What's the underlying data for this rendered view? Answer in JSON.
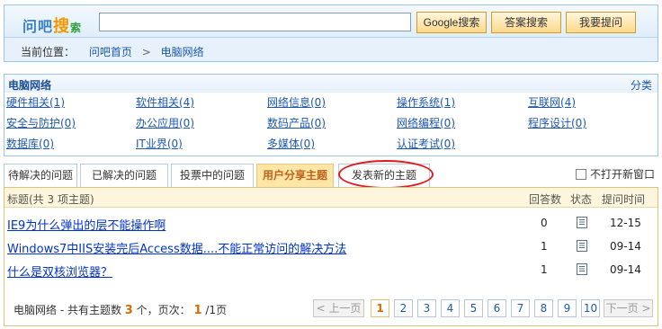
{
  "header": {
    "logo_a": "问吧",
    "logo_b": "搜",
    "logo_c": "索",
    "search_value": "",
    "buttons": {
      "google": "Google搜索",
      "answer": "答案搜索",
      "ask": "我要提问"
    }
  },
  "breadcrumb": {
    "label": "当前位置：",
    "home": "问吧首页",
    "separator": ">",
    "current": "电脑网络"
  },
  "categories": {
    "title": "电脑网络",
    "more": "分类",
    "items": [
      "硬件相关(1)",
      "软件相关(4)",
      "网络信息(0)",
      "操作系统(1)",
      "互联网(4)",
      "安全与防护(0)",
      "办公应用(0)",
      "数码产品(0)",
      "网络编程(0)",
      "程序设计(0)",
      "数据库(0)",
      "IT业界(0)",
      "多媒体(0)",
      "认证考试(0)"
    ]
  },
  "tabs": {
    "items": [
      "待解决的问题",
      "已解决的问题",
      "投票中的问题",
      "用户分享主题",
      "发表新的主题"
    ],
    "active_index": 3,
    "new_window": "不打开新窗口"
  },
  "table": {
    "head": {
      "title": "标题(共 3 项主题)",
      "count": "回答数",
      "status": "状态",
      "time": "提问时间"
    },
    "rows": [
      {
        "title": "IE9为什么弹出的层不能操作啊",
        "count": "0",
        "time": "12-15"
      },
      {
        "title": "Windows7中IIS安装完后Access数据....不能正常访问的解决方法",
        "count": "1",
        "time": "09-14"
      },
      {
        "title": "什么是双核浏览器？",
        "count": "1",
        "time": "09-14"
      }
    ]
  },
  "summary": {
    "prefix": "电脑网络 - 共有主题数",
    "total": "3",
    "mid": "个，页次：",
    "page": "1",
    "pages": "/1页"
  },
  "pager": {
    "prev": "< 上一页",
    "pages": [
      "1",
      "2",
      "3",
      "4",
      "5",
      "6",
      "7",
      "8",
      "9",
      "10"
    ],
    "current": "1",
    "next": "下一页 >"
  },
  "colors": {
    "accent": "#3a80c8",
    "highlight_ring": "#e01b1b",
    "active_tab": "#fde6a6"
  }
}
